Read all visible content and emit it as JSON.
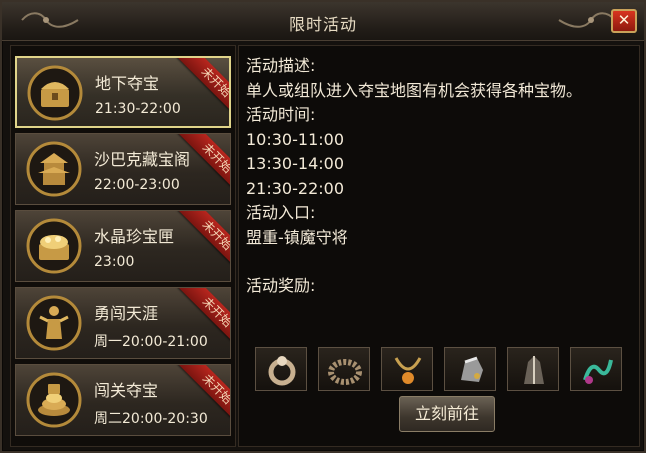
{
  "window": {
    "title": "限时活动",
    "close_label": "✕"
  },
  "events": [
    {
      "name": "地下夺宝",
      "time": "21:30-22:00",
      "badge": "未开始",
      "icon": "treasure-chest-icon",
      "selected": true
    },
    {
      "name": "沙巴克藏宝阁",
      "time": "22:00-23:00",
      "badge": "未开始",
      "icon": "pagoda-icon",
      "selected": false
    },
    {
      "name": "水晶珍宝匣",
      "time": "23:00",
      "badge": "未开始",
      "icon": "crystal-chest-icon",
      "selected": false
    },
    {
      "name": "勇闯天涯",
      "time": "周一20:00-21:00",
      "badge": "未开始",
      "icon": "warrior-icon",
      "selected": false
    },
    {
      "name": "闯关夺宝",
      "time": "周二20:00-20:30",
      "badge": "未开始",
      "icon": "gold-pile-icon",
      "selected": false
    }
  ],
  "detail": {
    "desc_label": "活动描述:",
    "desc_text": "单人或组队进入夺宝地图有机会获得各种宝物。",
    "time_label": "活动时间:",
    "times": [
      "10:30-11:00",
      "13:30-14:00",
      "21:30-22:00"
    ],
    "entry_label": "活动入口:",
    "entry_text": "盟重-镇魔守将",
    "reward_label": "活动奖励:",
    "rewards": [
      "ring-icon",
      "bracelet-icon",
      "necklace-icon",
      "helmet-icon",
      "armor-icon",
      "serpent-icon"
    ],
    "go_button": "立刻前往"
  },
  "colors": {
    "accent_gold": "#e0d48a",
    "badge_red": "#b8261e",
    "text": "#f2e9d7"
  }
}
